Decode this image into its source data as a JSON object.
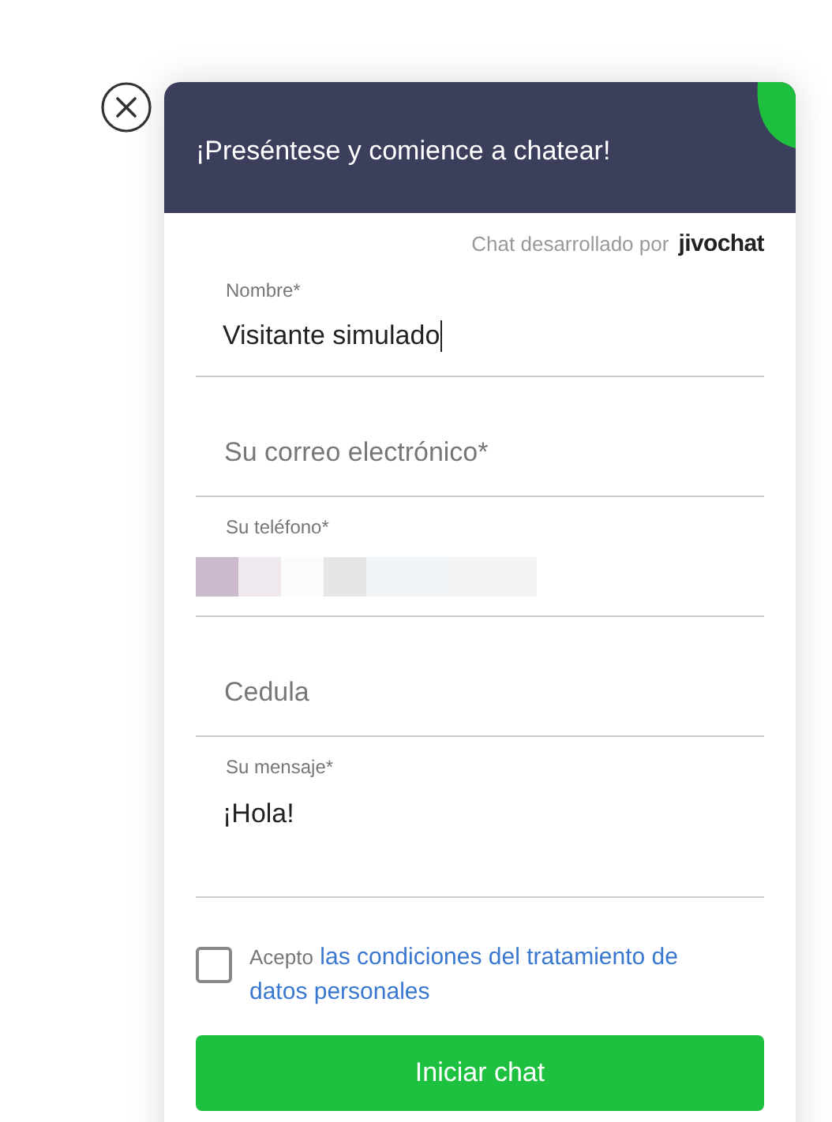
{
  "header": {
    "title": "¡Preséntese y comience a chatear!"
  },
  "powered_by": {
    "text": "Chat desarrollado por",
    "brand": "jivochat"
  },
  "fields": [
    {
      "kind": "input",
      "label": "Nombre*",
      "value": "Visitante simulado",
      "focused": true
    },
    {
      "kind": "input",
      "placeholder": "Su correo electrónico*"
    },
    {
      "kind": "input",
      "label": "Su teléfono*",
      "redacted": true
    },
    {
      "kind": "input",
      "placeholder": "Cedula"
    },
    {
      "kind": "textarea",
      "label": "Su mensaje*",
      "value": "¡Hola!"
    }
  ],
  "consent": {
    "checked": false,
    "text": "Acepto",
    "link": "las condiciones del tratamiento de datos personales"
  },
  "submit": {
    "label": "Iniciar chat"
  }
}
